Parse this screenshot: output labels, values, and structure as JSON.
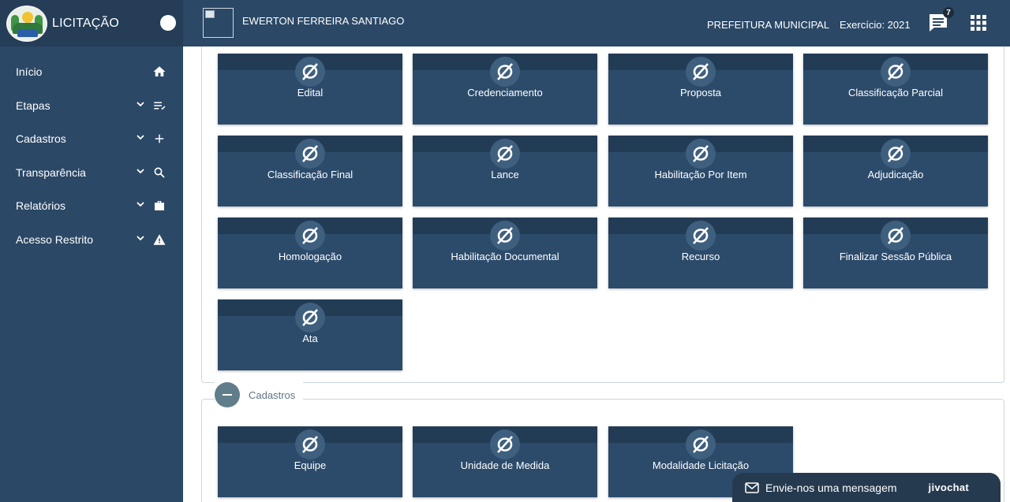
{
  "sidebar": {
    "app_title": "LICITAÇÃO",
    "items": [
      {
        "label": "Início",
        "icon": "home-icon"
      },
      {
        "label": "Etapas",
        "icon": "checklist-icon"
      },
      {
        "label": "Cadastros",
        "icon": "plus-icon"
      },
      {
        "label": "Transparência",
        "icon": "search-icon"
      },
      {
        "label": "Relatórios",
        "icon": "briefcase-icon"
      },
      {
        "label": "Acesso Restrito",
        "icon": "warning-icon"
      }
    ]
  },
  "header": {
    "user_name": "EWERTON FERREIRA SANTIAGO",
    "organization": "PREFEITURA MUNICIPAL",
    "exercise": "Exercício: 2021",
    "notification_count": "7"
  },
  "stages": {
    "cards": [
      {
        "label": "Edital"
      },
      {
        "label": "Credenciamento"
      },
      {
        "label": "Proposta"
      },
      {
        "label": "Classificação Parcial"
      },
      {
        "label": "Classificação Final"
      },
      {
        "label": "Lance"
      },
      {
        "label": "Habilitação Por Item"
      },
      {
        "label": "Adjudicação"
      },
      {
        "label": "Homologação"
      },
      {
        "label": "Habilitação Documental"
      },
      {
        "label": "Recurso"
      },
      {
        "label": "Finalizar Sessão Pública"
      },
      {
        "label": "Ata"
      }
    ]
  },
  "registrations": {
    "legend": "Cadastros",
    "cards": [
      {
        "label": "Equipe"
      },
      {
        "label": "Unidade de Medida"
      },
      {
        "label": "Modalidade Licitação"
      }
    ]
  },
  "chat_widget": {
    "message": "Envie-nos uma mensagem",
    "brand": "jivochat"
  },
  "colors": {
    "sidebar_bg": "#2b4866",
    "card_bg": "#2c4b6b",
    "card_strip": "#233c56"
  }
}
